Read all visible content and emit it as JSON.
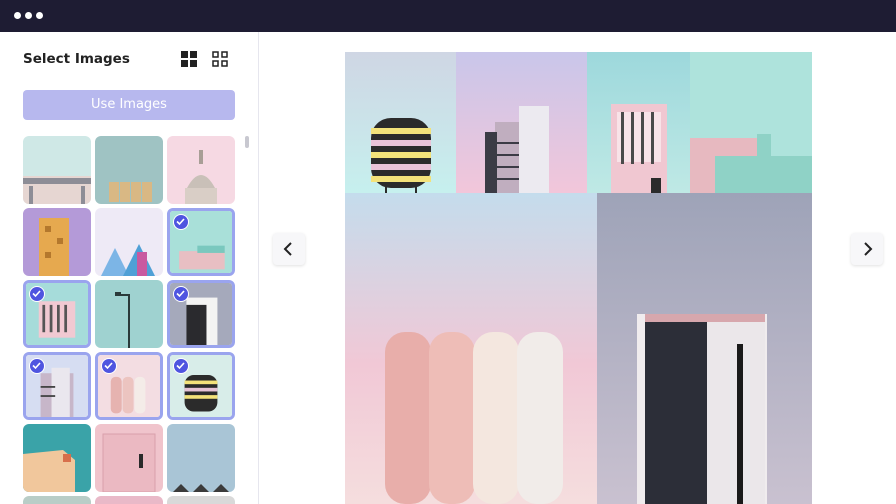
{
  "window": {
    "controls": [
      "dot-icon",
      "dot-icon",
      "dot-icon"
    ]
  },
  "sidebar": {
    "title": "Select Images",
    "use_button_label": "Use Images",
    "view_icons": [
      "grid-large-icon",
      "grid-outline-icon"
    ],
    "thumbnails": [
      {
        "subject": "overpass building",
        "selected": false
      },
      {
        "subject": "silos",
        "selected": false
      },
      {
        "subject": "capitol dome",
        "selected": false
      },
      {
        "subject": "orange tower",
        "selected": false
      },
      {
        "subject": "glass buildings",
        "selected": false
      },
      {
        "subject": "mint rooftop",
        "selected": true
      },
      {
        "subject": "balcony facade",
        "selected": true
      },
      {
        "subject": "street lamp",
        "selected": true
      },
      {
        "subject": "dark tower",
        "selected": true
      },
      {
        "subject": "striped building",
        "selected": true
      },
      {
        "subject": "pink silos",
        "selected": true
      },
      {
        "subject": "round striped tower",
        "selected": true
      },
      {
        "subject": "orange wall",
        "selected": false
      },
      {
        "subject": "pink door",
        "selected": false
      },
      {
        "subject": "rooftops",
        "selected": false
      }
    ]
  },
  "main": {
    "prev_icon": "chevron-left-icon",
    "next_icon": "chevron-right-icon"
  },
  "colors": {
    "titlebar": "#1e1c33",
    "accent": "#4f55e0",
    "button": "#b7b8ee"
  }
}
